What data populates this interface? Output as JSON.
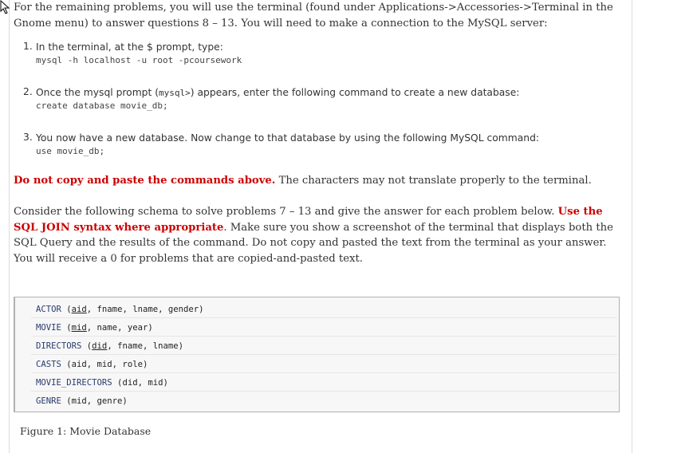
{
  "intro": {
    "text": "For the remaining problems, you will use the terminal (found under Applications->Accessories->Terminal in the Gnome menu) to answer questions 8 – 13. You will need to make a connection to the MySQL server:"
  },
  "steps": [
    {
      "num": "1.",
      "text": "In the terminal, at the $ prompt, type:",
      "code": "mysql -h localhost -u root -pcoursework"
    },
    {
      "num": "2.",
      "text_before": "Once the mysql prompt (",
      "inline_code": "mysql>",
      "text_after": ") appears, enter the following command to create a new database:",
      "code": "create database movie_db;"
    },
    {
      "num": "3.",
      "text": "You now have a new database. Now change to that database by using the following MySQL command:",
      "code": "use movie_db;"
    }
  ],
  "warning": {
    "bold_red": "Do not copy and paste the commands above.",
    "rest": " The characters may not translate properly to the terminal."
  },
  "schema_paragraph": {
    "before": "Consider the following schema to solve problems 7 – 13 and give the answer for each problem below. ",
    "bold_red": "Use the SQL JOIN syntax where appropriate",
    "after": ". Make sure you show a screenshot of the terminal that displays both the SQL Query and the results of the command. Do not copy and pasted the text from the terminal as your answer. You will receive a 0 for problems that are copied-and-pasted text."
  },
  "schema": [
    {
      "table": "ACTOR",
      "key": "aid",
      "rest": ", fname, lname, gender)"
    },
    {
      "table": "MOVIE",
      "key": "mid",
      "rest": ", name, year)"
    },
    {
      "table": "DIRECTORS",
      "key": "did",
      "rest": ", fname, lname)"
    },
    {
      "table": "CASTS",
      "key": "",
      "rest": "aid, mid, role)"
    },
    {
      "table": "MOVIE_DIRECTORS",
      "key": "",
      "rest": "did, mid)"
    },
    {
      "table": "GENRE",
      "key": "",
      "rest": "mid, genre)"
    }
  ],
  "caption": "Figure 1: Movie Database"
}
